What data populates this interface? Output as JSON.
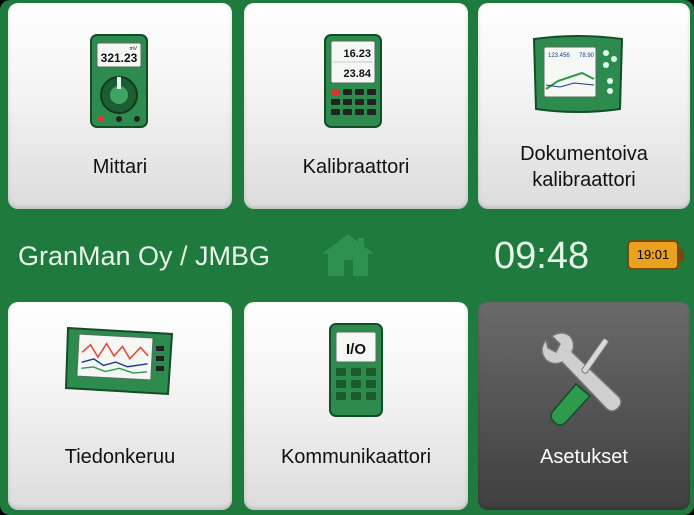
{
  "tiles": {
    "meter": {
      "label": "Mittari",
      "icon": "meter-icon"
    },
    "calibrator": {
      "label": "Kalibraattori",
      "icon": "calibrator-icon"
    },
    "documenting": {
      "label_line1": "Dokumentoiva",
      "label_line2": "kalibraattori",
      "icon": "documenting-calibrator-icon"
    },
    "datalogger": {
      "label": "Tiedonkeruu",
      "icon": "datalogger-icon"
    },
    "communicator": {
      "label": "Kommunikaattori",
      "icon": "communicator-icon"
    },
    "settings": {
      "label": "Asetukset",
      "icon": "wrench-screwdriver-icon"
    }
  },
  "status_bar": {
    "site_name": "GranMan Oy / JMBG",
    "time": "09:48",
    "battery_time": "19:01",
    "home_icon": "home-icon",
    "battery_icon": "battery-icon"
  },
  "icon_text": {
    "meter_reading": "321.23",
    "meter_unit": "mV",
    "calib_upper": "16.23",
    "calib_lower": "23.84",
    "doc_val_left": "123.456",
    "doc_val_right": "78.90",
    "io_text": "I/O"
  },
  "colors": {
    "frame_green": "#1f7a3d",
    "tile_light": "#f3f3f3",
    "tile_dark": "#525252",
    "battery_orange": "#e8a21f"
  }
}
